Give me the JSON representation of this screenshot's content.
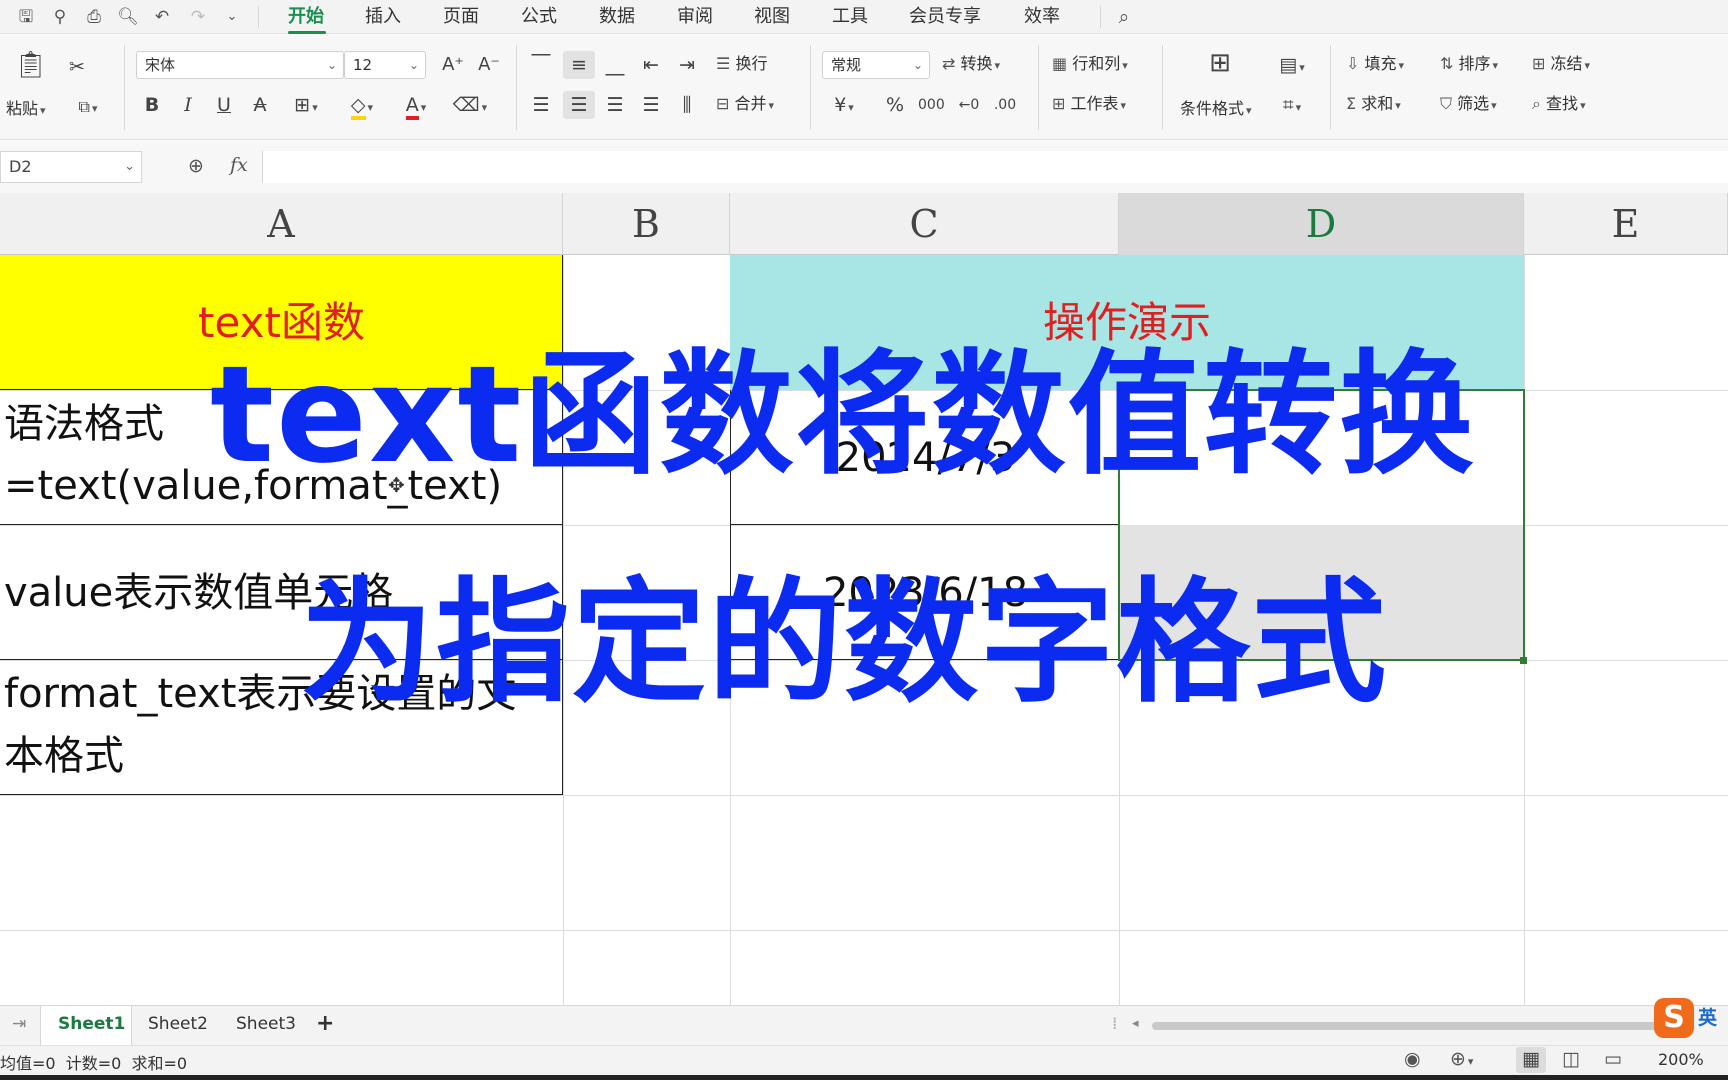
{
  "menu": {
    "items": [
      "开始",
      "插入",
      "页面",
      "公式",
      "数据",
      "审阅",
      "视图",
      "工具",
      "会员专享",
      "效率"
    ],
    "active": "开始"
  },
  "ribbon": {
    "paste_label": "粘贴",
    "font_name": "宋体",
    "font_size": "12",
    "wrap_label": "换行",
    "merge_label": "合并",
    "number_format": "常规",
    "convert_label": "转换",
    "rowcol_label": "行和列",
    "worksheet_label": "工作表",
    "conditional_label": "条件格式",
    "fill_label": "填充",
    "sort_label": "排序",
    "freeze_label": "冻结",
    "sum_label": "求和",
    "filter_label": "筛选",
    "find_label": "查找",
    "font_color": "#e02020",
    "fill_color": "#ffd400"
  },
  "formula_bar": {
    "name_box": "D2",
    "fx_label": "fx",
    "content": ""
  },
  "columns": [
    "A",
    "B",
    "C",
    "D",
    "E"
  ],
  "selected_column": "D",
  "cells": {
    "a1": "text函数",
    "c1": "操作演示",
    "a2_line1": "语法格式",
    "a2_line2": "=text(value,format_text)",
    "c2": "2024/7/3",
    "a3": "value表示数值单元格",
    "c3": "2023/6/18",
    "a4_line1": "format_text表示要设置的文",
    "a4_line2": "本格式"
  },
  "colors": {
    "a1_fill": "#ffff00",
    "c1_fill": "#a8e6e6",
    "header_text": "#e02020",
    "selection_border": "#2f7d32",
    "overlay_text": "#0c2bf0"
  },
  "overlay": {
    "line1": "text函数将数值转换",
    "line2": "为指定的数字格式"
  },
  "sheets": [
    "Sheet1",
    "Sheet2",
    "Sheet3"
  ],
  "active_sheet": "Sheet1",
  "add_sheet": "+",
  "ime_label": "英",
  "status": {
    "text": "均值=0  计数=0  求和=0",
    "zoom": "200%"
  }
}
